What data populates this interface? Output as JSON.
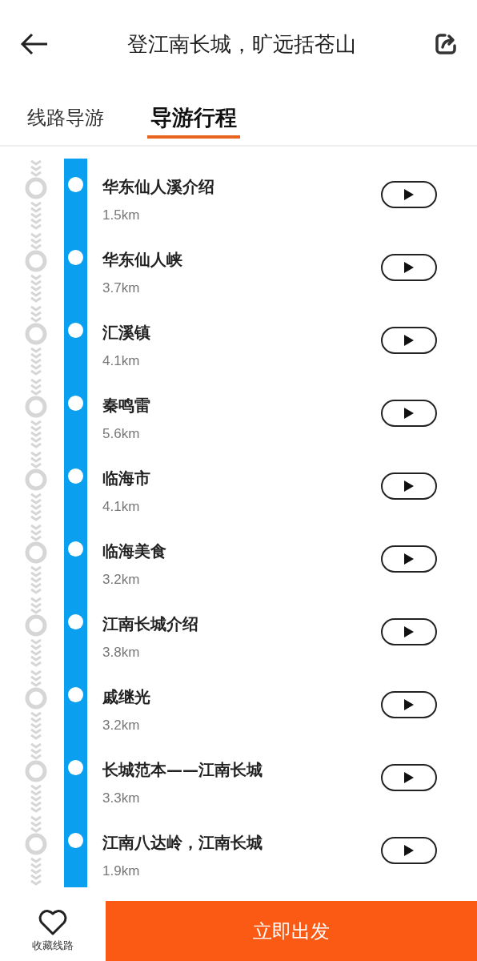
{
  "header": {
    "title": "登江南长城，旷远括苍山"
  },
  "tabs": [
    {
      "label": "线路导游",
      "selected": false
    },
    {
      "label": "导游行程",
      "selected": true
    }
  ],
  "stops": [
    {
      "name": "华东仙人溪介绍",
      "distance": "1.5km"
    },
    {
      "name": "华东仙人峡",
      "distance": "3.7km"
    },
    {
      "name": "汇溪镇",
      "distance": "4.1km"
    },
    {
      "name": "秦鸣雷",
      "distance": "5.6km"
    },
    {
      "name": "临海市",
      "distance": "4.1km"
    },
    {
      "name": "临海美食",
      "distance": "3.2km"
    },
    {
      "name": "江南长城介绍",
      "distance": "3.8km"
    },
    {
      "name": "戚继光",
      "distance": "3.2km"
    },
    {
      "name": "长城范本——江南长城",
      "distance": "3.3km"
    },
    {
      "name": "江南八达岭，江南长城",
      "distance": "1.9km"
    }
  ],
  "bottom_bar": {
    "favorite_label": "收藏线路",
    "start_button": "立即出发"
  }
}
